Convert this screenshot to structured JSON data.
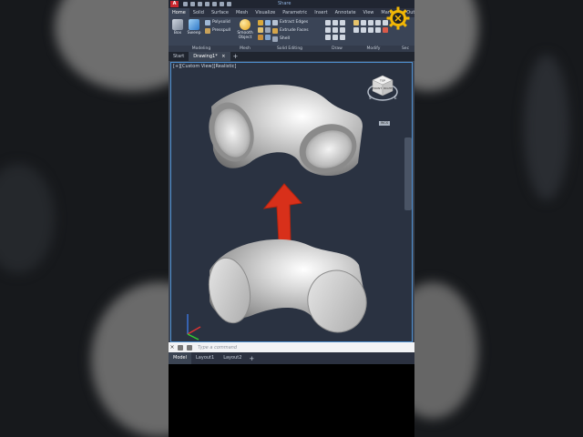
{
  "app": {
    "logo_text": "A",
    "share_label": "Share"
  },
  "ribbon_tabs": [
    {
      "label": "Home",
      "active": true
    },
    {
      "label": "Solid",
      "active": false
    },
    {
      "label": "Surface",
      "active": false
    },
    {
      "label": "Mesh",
      "active": false
    },
    {
      "label": "Visualize",
      "active": false
    },
    {
      "label": "Parametric",
      "active": false
    },
    {
      "label": "Insert",
      "active": false
    },
    {
      "label": "Annotate",
      "active": false
    },
    {
      "label": "View",
      "active": false
    },
    {
      "label": "Manage",
      "active": false
    },
    {
      "label": "Outp",
      "active": false
    }
  ],
  "ribbon": {
    "modeling": {
      "label": "Modeling",
      "box_label": "Box",
      "sweep_label": "Sweep",
      "polysolid_label": "Polysolid",
      "presspull_label": "Presspull"
    },
    "mesh": {
      "label": "Mesh",
      "smooth_object_label": "Smooth Object"
    },
    "solid_editing": {
      "label": "Solid Editing",
      "extract_edges_label": "Extract Edges",
      "extrude_faces_label": "Extrude Faces",
      "shell_label": "Shell"
    },
    "draw_label": "Draw",
    "modify_label": "Modify",
    "section_label": "Sec"
  },
  "doc_tabs": [
    {
      "label": "Start",
      "active": false
    },
    {
      "label": "Drawing1*",
      "active": true
    }
  ],
  "viewport": {
    "view_label": "[+][Custom View][Realistic]",
    "cube_faces": {
      "top": "TOP",
      "front": "FRONT",
      "right": "RIGHT"
    },
    "compass": {
      "s": "S",
      "e": "E"
    },
    "wcs_label": "WCS"
  },
  "command_line": {
    "placeholder": "Type a command"
  },
  "layout_tabs": [
    {
      "label": "Model",
      "active": true
    },
    {
      "label": "Layout1",
      "active": false
    },
    {
      "label": "Layout2",
      "active": false
    }
  ],
  "colors": {
    "accent": "#4d8fd0",
    "arrow": "#d8301a",
    "viewport_bg": "#2a3241",
    "ribbon_bg": "#3a4456"
  },
  "icons": [
    "app-logo-icon",
    "arrow-up-icon",
    "viewcube-icon",
    "ucs-icon",
    "gear-logo-icon",
    "close-icon",
    "plus-icon"
  ]
}
